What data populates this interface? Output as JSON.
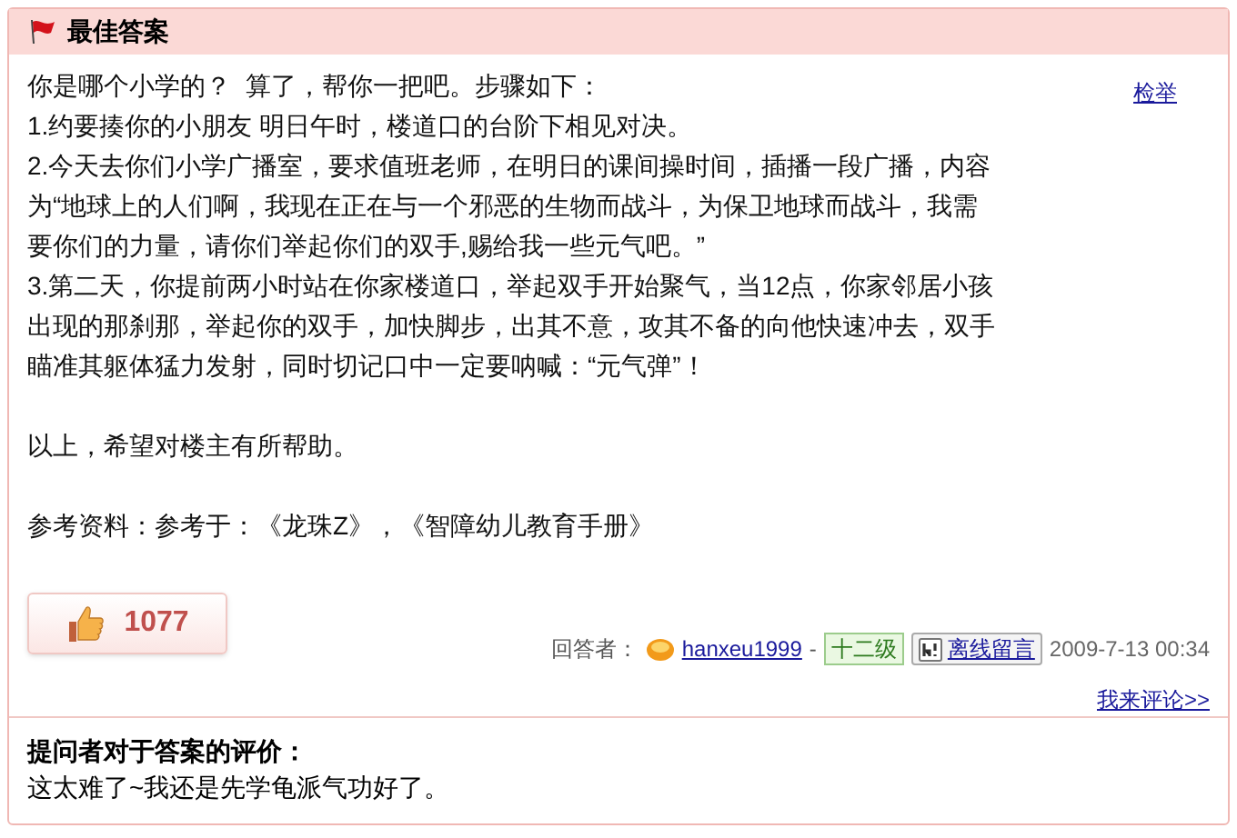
{
  "header": {
    "title": "最佳答案"
  },
  "report_link": "检举",
  "paragraphs": [
    "你是哪个小学的？  算了，帮你一把吧。步骤如下：",
    "1.约要揍你的小朋友 明日午时，楼道口的台阶下相见对决。",
    "2.今天去你们小学广播室，要求值班老师，在明日的课间操时间，插播一段广播，内容为“地球上的人们啊，我现在正在与一个邪恶的生物而战斗，为保卫地球而战斗，我需要你们的力量，请你们举起你们的双手,赐给我一些元气吧。”",
    "3.第二天，你提前两小时站在你家楼道口，举起双手开始聚气，当12点，你家邻居小孩出现的那刹那，举起你的双手，加快脚步，出其不意，攻其不备的向他快速冲去，双手瞄准其躯体猛力发射，同时切记口中一定要呐喊：“元气弹”！"
  ],
  "closing": "以上，希望对楼主有所帮助。",
  "references": "参考资料：参考于：《龙珠Z》，《智障幼儿教育手册》",
  "like_count": "1077",
  "answerer": {
    "label": "回答者：",
    "name": "hanxeu1999",
    "separator": "-",
    "level": "十二级",
    "message_button": "离线留言",
    "date": "2009-7-13 00:34"
  },
  "comment_link": "我来评论>>",
  "evaluation": {
    "title": "提问者对于答案的评价：",
    "text": "这太难了~我还是先学龟派气功好了。"
  }
}
